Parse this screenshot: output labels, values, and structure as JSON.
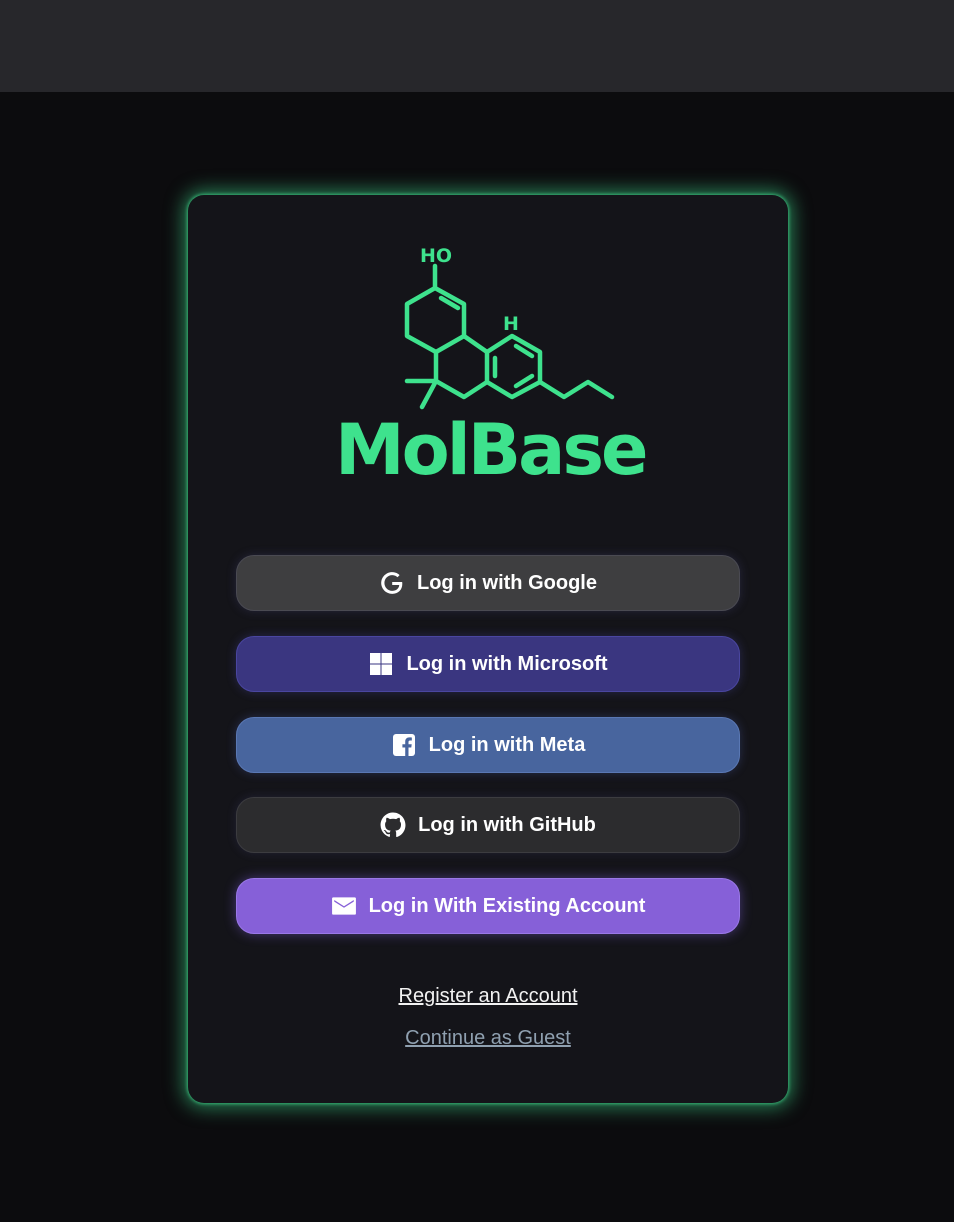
{
  "colors": {
    "accent": "#3ee28d",
    "card_bg": "#141419",
    "page_bg": "#0c0c0e"
  },
  "logo": {
    "text": "MolBase",
    "icon": "molecule-structure-icon",
    "labels": [
      "HO",
      "H"
    ]
  },
  "buttons": [
    {
      "label": "Log in with Google",
      "icon": "google-icon",
      "color": "#3e3e40"
    },
    {
      "label": "Log in with Microsoft",
      "icon": "microsoft-icon",
      "color": "#3a3680"
    },
    {
      "label": "Log in with Meta",
      "icon": "facebook-icon",
      "color": "#48659e"
    },
    {
      "label": "Log in with GitHub",
      "icon": "github-icon",
      "color": "#2c2c2e"
    },
    {
      "label": "Log in With Existing Account",
      "icon": "mail-icon",
      "color": "#8660d8"
    }
  ],
  "links": {
    "register": "Register an Account",
    "guest": "Continue as Guest"
  }
}
